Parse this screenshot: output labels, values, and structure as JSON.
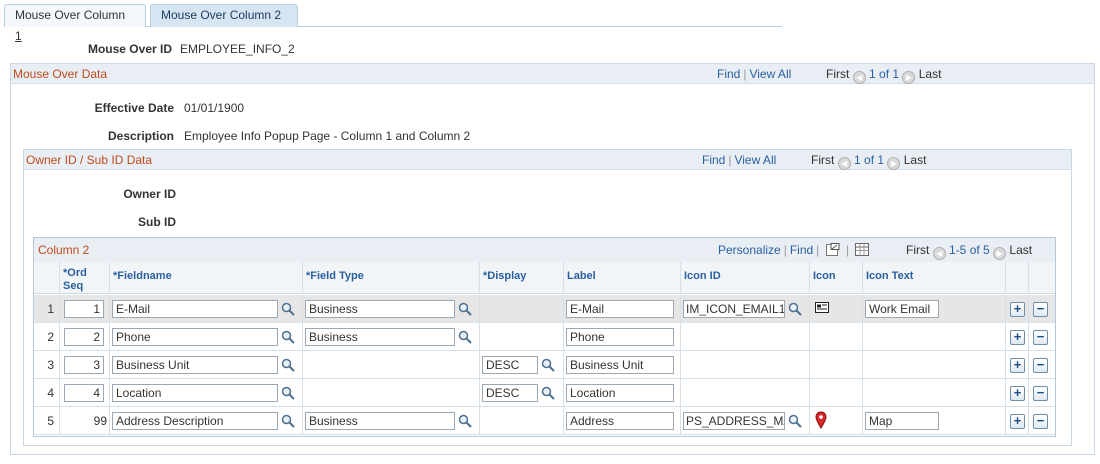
{
  "tabs": [
    {
      "label_pre": "Mouse Over Column ",
      "label_key": "1"
    },
    {
      "label": "Mouse Over Column 2"
    }
  ],
  "mouse_over_id": {
    "label": "Mouse Over ID",
    "value": "EMPLOYEE_INFO_2"
  },
  "mouse_over_data": {
    "title": "Mouse Over Data",
    "nav": {
      "find": "Find",
      "view_all": "View All",
      "first": "First",
      "count": "1 of 1",
      "last": "Last"
    },
    "effective_date": {
      "label": "Effective Date",
      "value": "01/01/1900"
    },
    "description": {
      "label": "Description",
      "value": "Employee Info Popup Page - Column 1 and Column 2"
    }
  },
  "owner_sub": {
    "title": "Owner ID / Sub ID Data",
    "nav": {
      "find": "Find",
      "view_all": "View All",
      "first": "First",
      "count": "1 of 1",
      "last": "Last"
    },
    "owner_id_label": "Owner ID",
    "sub_id_label": "Sub ID"
  },
  "grid": {
    "title": "Column 2",
    "nav": {
      "personalize": "Personalize",
      "find": "Find",
      "first": "First",
      "count": "1-5 of 5",
      "last": "Last"
    },
    "headers": {
      "ord_seq_1": "*Ord",
      "ord_seq_2": "Seq",
      "fieldname": "*Fieldname",
      "field_type": "*Field Type",
      "display": "*Display",
      "label": "Label",
      "icon_id": "Icon ID",
      "icon": "Icon",
      "icon_text": "Icon Text"
    },
    "rows": [
      {
        "num": "1",
        "seq": "1",
        "fieldname": "E-Mail",
        "field_type": "Business",
        "display": "",
        "label": "E-Mail",
        "icon_id": "IM_ICON_EMAIL1",
        "icon": "email-card-icon",
        "icon_text": "Work Email"
      },
      {
        "num": "2",
        "seq": "2",
        "fieldname": "Phone",
        "field_type": "Business",
        "display": "",
        "label": "Phone",
        "icon_id": "",
        "icon": "",
        "icon_text": ""
      },
      {
        "num": "3",
        "seq": "3",
        "fieldname": "Business Unit",
        "field_type": "",
        "display": "DESC",
        "label": "Business Unit",
        "icon_id": "",
        "icon": "",
        "icon_text": ""
      },
      {
        "num": "4",
        "seq": "4",
        "fieldname": "Location",
        "field_type": "",
        "display": "DESC",
        "label": "Location",
        "icon_id": "",
        "icon": "",
        "icon_text": ""
      },
      {
        "num": "5",
        "seq": "99",
        "fieldname": "Address Description",
        "field_type": "Business",
        "display": "",
        "label": "Address",
        "icon_id": "PS_ADDRESS_MAP",
        "icon": "map-pin-icon",
        "icon_text": "Map"
      }
    ],
    "add_glyph": "+",
    "remove_glyph": "−"
  }
}
